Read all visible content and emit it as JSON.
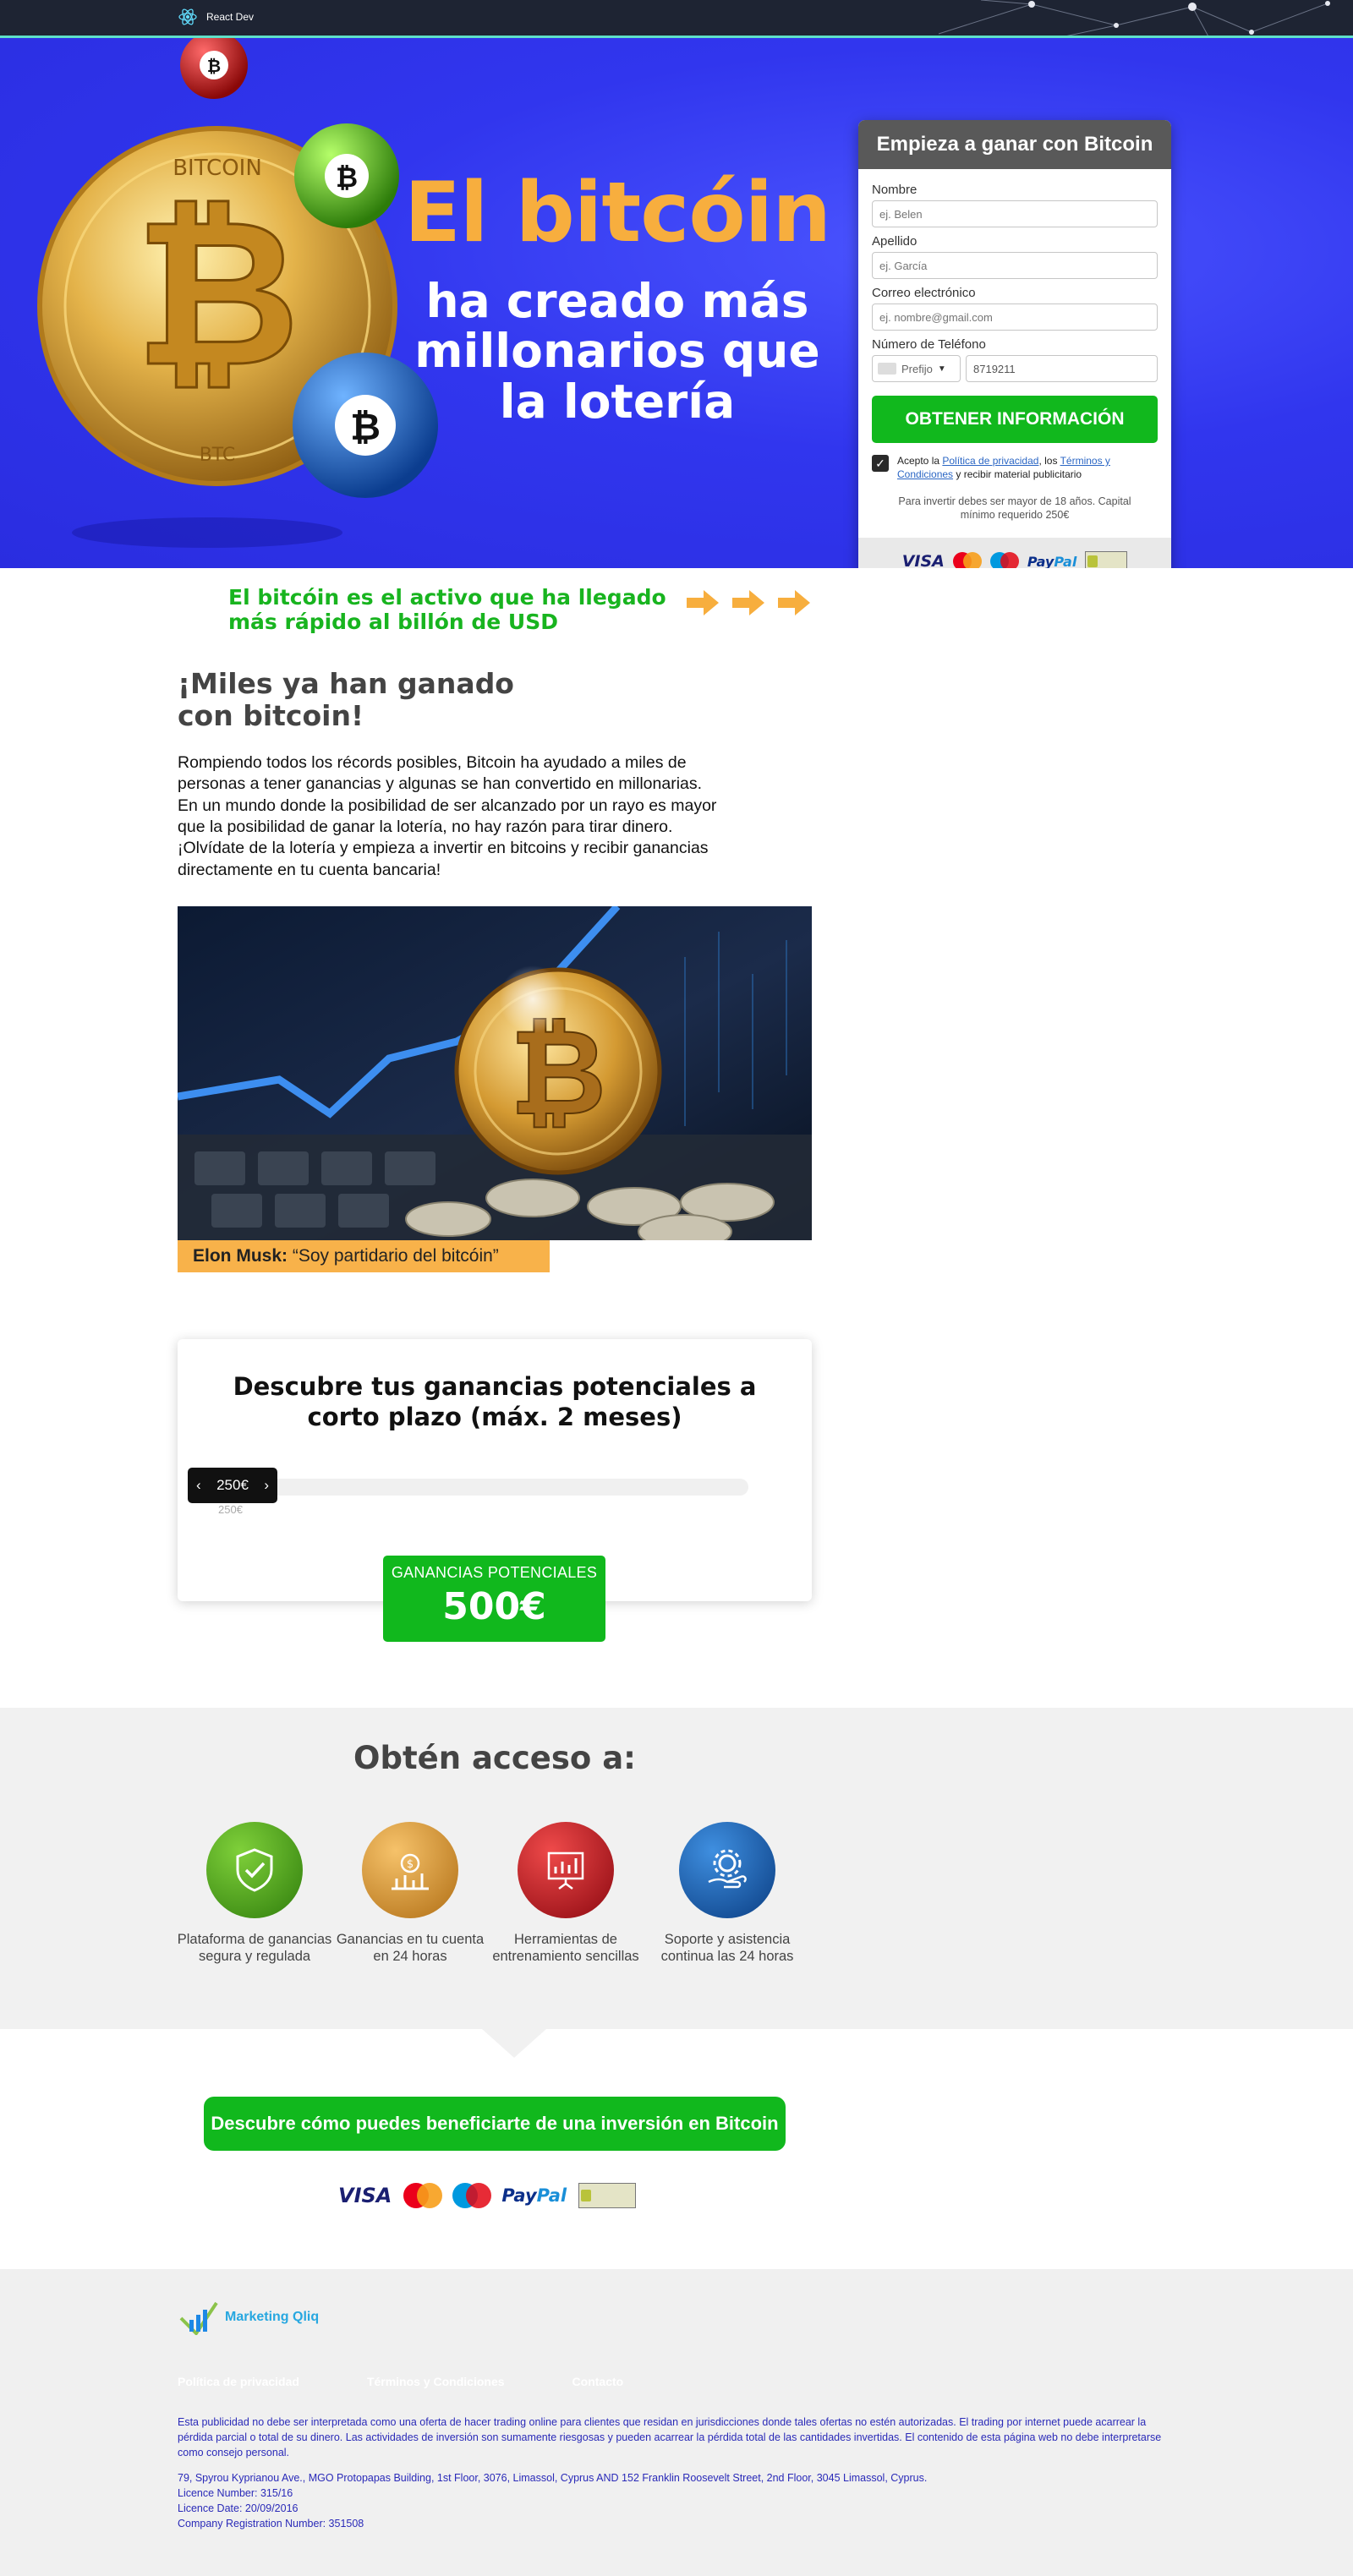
{
  "topbar": {
    "brand": "React Dev"
  },
  "hero": {
    "title_line1": "El bitcóin",
    "title_line2": "ha creado más millonarios que la lotería"
  },
  "form": {
    "title": "Empieza a ganar con Bitcoin",
    "first_name_label": "Nombre",
    "first_name_placeholder": "ej. Belen",
    "last_name_label": "Apellido",
    "last_name_placeholder": "ej. García",
    "email_label": "Correo electrónico",
    "email_placeholder": "ej. nombre@gmail.com",
    "phone_label": "Número de Teléfono",
    "prefix_label": "Prefijo",
    "phone_value": "8719211",
    "submit_label": "OBTENER INFORMACIÓN",
    "consent_prefix": "Acepto la ",
    "privacy_link": "Política de privacidad",
    "consent_mid": ", los ",
    "terms_link": "Términos y Condiciones",
    "consent_suffix": " y recibir material publicitario",
    "age_note": "Para invertir debes ser mayor de 18 años. Capital mínimo requerido 250€"
  },
  "payments": {
    "visa": "VISA",
    "paypal_a": "Pay",
    "paypal_b": "Pal"
  },
  "fast": {
    "text": "El bitcóin es el activo que ha llegado más rápido al billón de USD"
  },
  "miles": {
    "heading": "¡Miles ya han ganado con bitcoin!",
    "paragraph": "Rompiendo todos los récords posibles, Bitcoin ha ayudado a miles de personas a tener ganancias y algunas se han convertido en millonarias. En un mundo donde la posibilidad de ser alcanzado por un rayo es mayor que la posibilidad de ganar la lotería, no hay razón para tirar dinero. ¡Olvídate de la lotería y empieza a invertir en bitcoins y recibir ganancias directamente en tu cuenta bancaria!",
    "caption_name": "Elon Musk:",
    "caption_quote": " “Soy partidario del bitcóin”"
  },
  "calculator": {
    "title": "Descubre tus ganancias potenciales a corto plazo (máx. 2 meses)",
    "slider_value": "250€",
    "min_label": "250€",
    "gains_label": "GANANCIAS POTENCIALES",
    "gains_value": "500€"
  },
  "access": {
    "heading": "Obtén acceso a:",
    "features": [
      {
        "label": "Plataforma de ganancias segura y regulada",
        "icon": "shield-check-icon",
        "color": "#3f9b12"
      },
      {
        "label": "Ganancias en tu cuenta en 24 horas",
        "icon": "money-chart-icon",
        "color": "#e2962a"
      },
      {
        "label": "Herramientas de entrenamiento sencillas",
        "icon": "presentation-chart-icon",
        "color": "#c21420"
      },
      {
        "label": "Soporte y asistencia continua las 24 horas",
        "icon": "gear-hand-icon",
        "color": "#1565b0"
      }
    ]
  },
  "cta": {
    "label": "Descubre cómo puedes beneficiarte de una inversión en Bitcoin"
  },
  "footer": {
    "brand": "Marketing Qliq",
    "links": [
      "Política de privacidad",
      "Términos y Condiciones",
      "Contacto"
    ],
    "disclaimer": "Esta publicidad no debe ser interpretada como una oferta de hacer trading online para clientes que residan en jurisdicciones donde tales ofertas no estén autorizadas. El trading por internet puede acarrear la pérdida parcial o total de su dinero. Las actividades de inversión son sumamente riesgosas y pueden acarrear la pérdida total de las cantidades invertidas. El contenido de esta página web no debe interpretarse como consejo personal.",
    "address": "79, Spyrou Kyprianou Ave., MGO Protopapas Building, 1st Floor, 3076, Limassol, Cyprus AND 152 Franklin Roosevelt Street, 2nd Floor, 3045 Limassol, Cyprus.",
    "licence_number": "Licence Number: 315/16",
    "licence_date": "Licence Date: 20/09/2016",
    "company_reg": "Company Registration Number: 351508"
  },
  "colors": {
    "accent_green": "#11b81d",
    "hero_blue": "#3136ee",
    "title_orange": "#f7ae3e"
  }
}
